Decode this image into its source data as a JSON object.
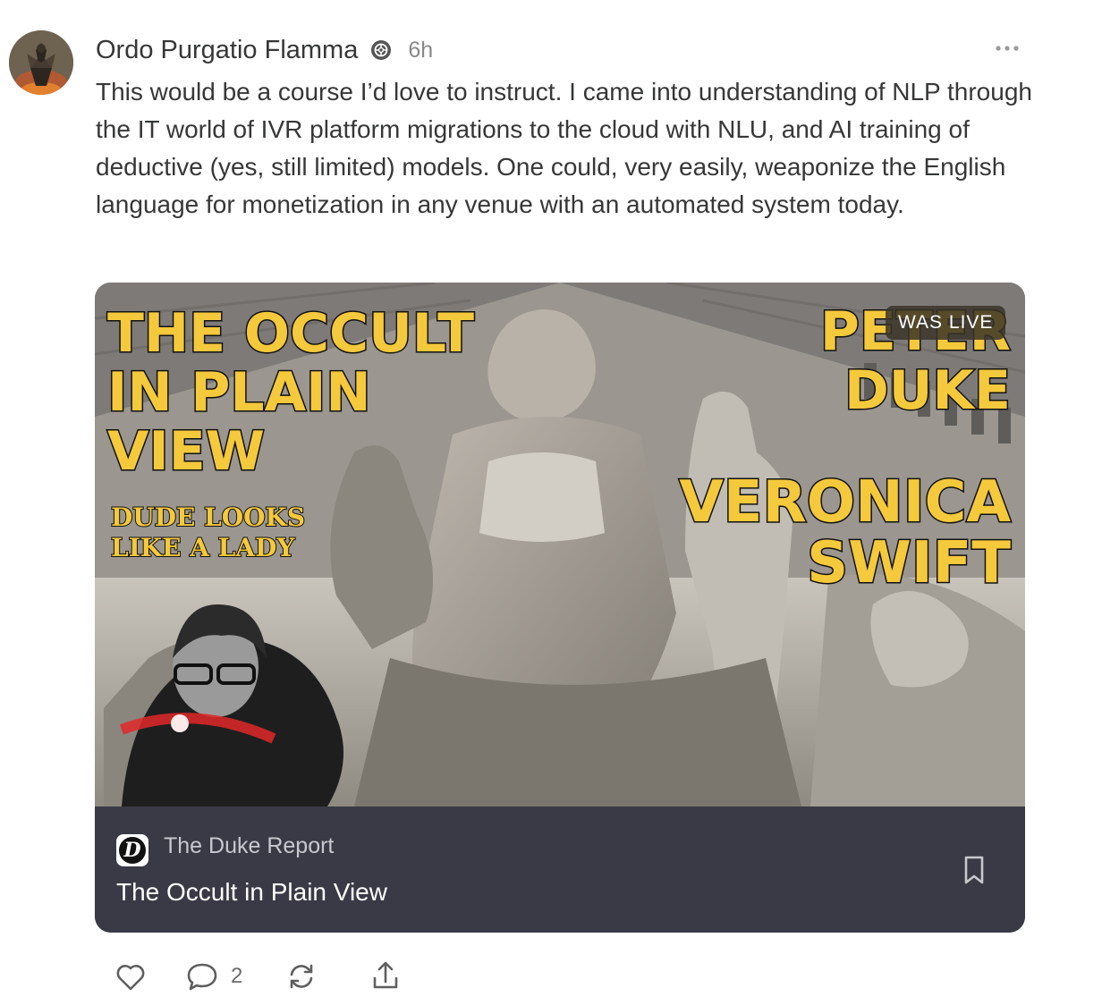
{
  "post": {
    "author": "Ordo Purgatio Flamma",
    "timestamp": "6h",
    "body": "This would be a course I’d love to instruct.  I came into understanding of NLP through the IT world of IVR platform migrations to the cloud with NLU, and AI training of deductive (yes, still limited) models.  One could, very easily, weaponize the English language for monetization in any venue with an automated system today.",
    "icons": {
      "badge": "subscriber-badge-icon",
      "more": "more-options-icon"
    }
  },
  "card": {
    "thumbnail_text": {
      "title": [
        "THE OCCULT",
        "IN PLAIN",
        "VIEW"
      ],
      "subtitle": [
        "DUDE LOOKS",
        "LIKE A LADY"
      ],
      "guest_top": [
        "PETER",
        "DUKE"
      ],
      "guest_bottom": [
        "VERONICA",
        "SWIFT"
      ]
    },
    "badge": "WAS LIVE",
    "publication": "The Duke Report",
    "title": "The Occult in Plain View",
    "colors": {
      "thumbnail_text": "#f5c93c",
      "meta_bg": "#3a3a46"
    }
  },
  "actions": {
    "like_icon": "heart-icon",
    "comment_icon": "comment-icon",
    "comment_count": "2",
    "restack_icon": "restack-icon",
    "share_icon": "share-icon"
  }
}
